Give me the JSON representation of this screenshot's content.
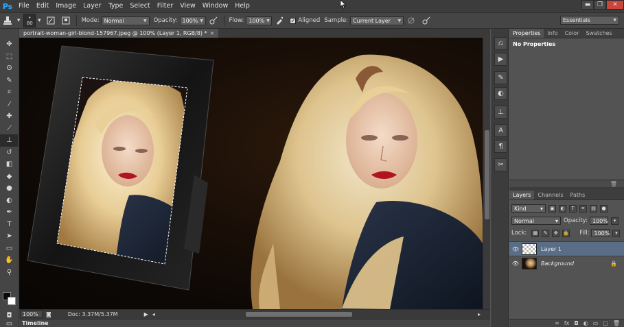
{
  "menu": {
    "logo": "Ps",
    "items": [
      "File",
      "Edit",
      "Image",
      "Layer",
      "Type",
      "Select",
      "Filter",
      "View",
      "Window",
      "Help"
    ]
  },
  "window_controls": {
    "minimize": "▬",
    "restore": "❐",
    "close": "✕"
  },
  "options": {
    "brush_size": "80",
    "mode_label": "Mode:",
    "mode_value": "Normal",
    "opacity_label": "Opacity:",
    "opacity_value": "100%",
    "flow_label": "Flow:",
    "flow_value": "100%",
    "aligned_label": "Aligned",
    "aligned_checked": "✓",
    "sample_label": "Sample:",
    "sample_value": "Current Layer",
    "workspace_value": "Essentials"
  },
  "document": {
    "tab_title": "portrait-woman-girl-blond-157967.jpeg @ 100% (Layer 1, RGB/8) *",
    "tab_close": "×"
  },
  "status": {
    "zoom": "100%",
    "doc_size": "Doc: 3.37M/5.37M"
  },
  "timeline_label": "Timeline",
  "properties_panel": {
    "tabs": [
      "Properties",
      "Info",
      "Color",
      "Swatches"
    ],
    "body_text": "No Properties"
  },
  "layers_panel": {
    "tabs": [
      "Layers",
      "Channels",
      "Paths"
    ],
    "filter_value": "Kind",
    "blend_value": "Normal",
    "opacity_label": "Opacity:",
    "opacity_value": "100%",
    "lock_label": "Lock:",
    "fill_label": "Fill:",
    "fill_value": "100%",
    "layers": [
      {
        "name": "Layer 1",
        "selected": true
      },
      {
        "name": "Background",
        "selected": false
      }
    ]
  },
  "colors": {
    "accent": "#31a8ff",
    "selected_layer": "#596d87",
    "foreground": "#0a0a0a",
    "background": "#ffffff"
  }
}
